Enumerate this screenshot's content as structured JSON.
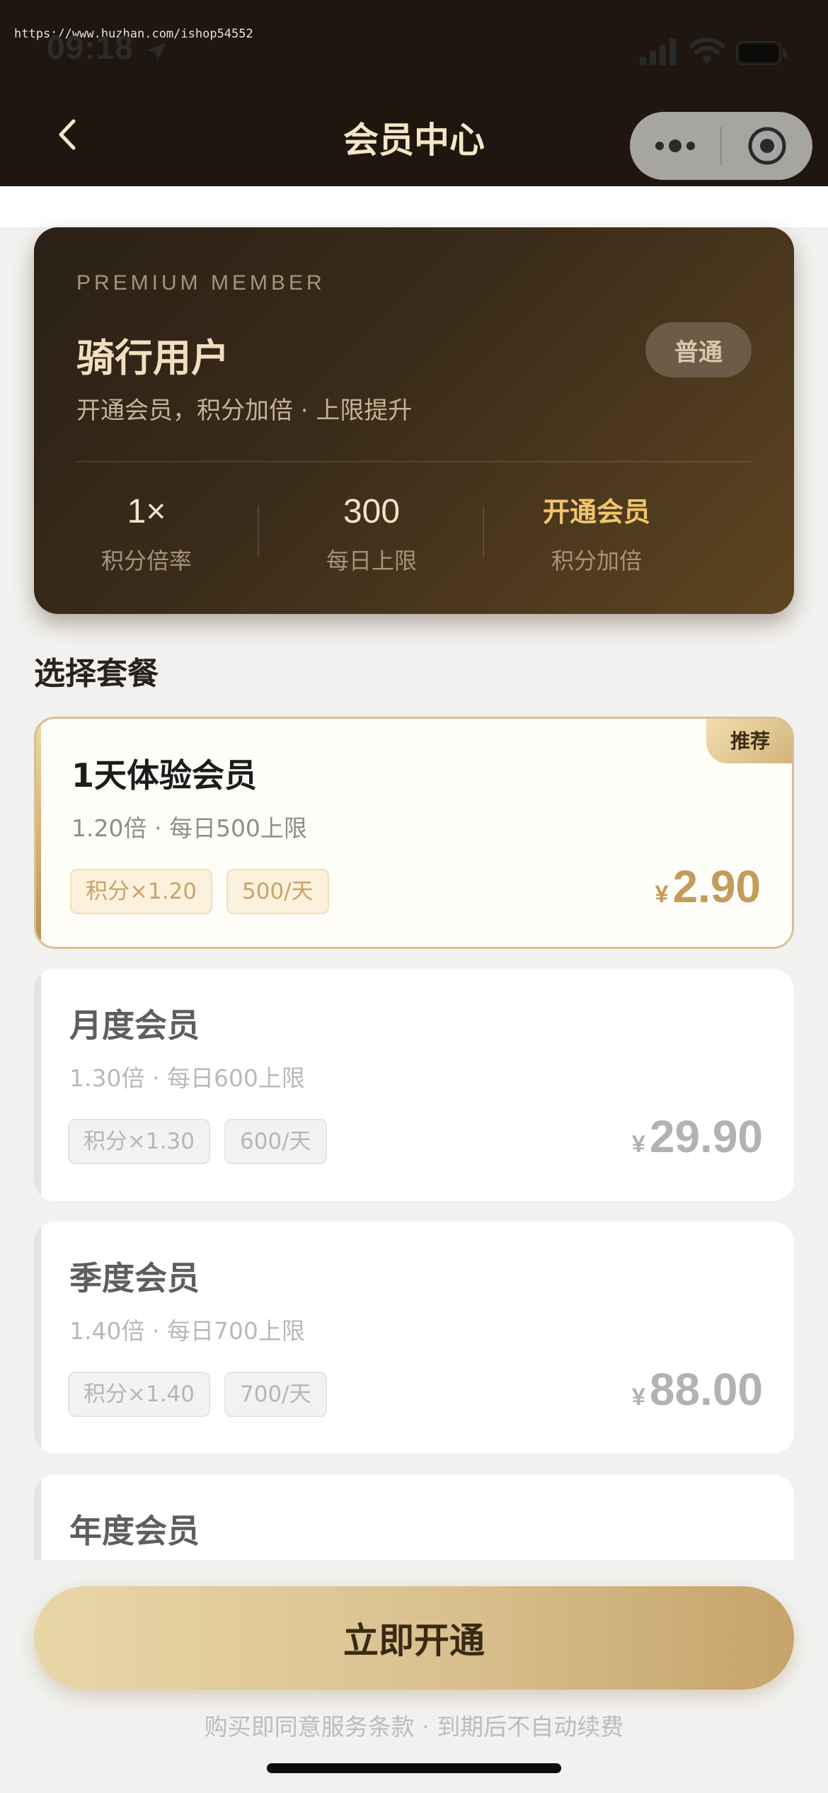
{
  "status_bar": {
    "watermark": "https://www.huzhan.com/ishop54552",
    "time": "09:18"
  },
  "header": {
    "title": "会员中心"
  },
  "member_card": {
    "eyebrow": "PREMIUM MEMBER",
    "title": "骑行用户",
    "subtitle": "开通会员，积分加倍 · 上限提升",
    "level_badge": "普通",
    "stats": [
      {
        "value": "1×",
        "label": "积分倍率"
      },
      {
        "value": "300",
        "label": "每日上限"
      },
      {
        "value": "开通会员",
        "label": "积分加倍"
      }
    ]
  },
  "section_title": "选择套餐",
  "plans": [
    {
      "name": "1天体验会员",
      "desc": "1.20倍 · 每日500上限",
      "tags": [
        "积分×1.20",
        "500/天"
      ],
      "currency": "¥",
      "price": "2.90",
      "badge": "推荐",
      "selected": true
    },
    {
      "name": "月度会员",
      "desc": "1.30倍 · 每日600上限",
      "tags": [
        "积分×1.30",
        "600/天"
      ],
      "currency": "¥",
      "price": "29.90",
      "selected": false
    },
    {
      "name": "季度会员",
      "desc": "1.40倍 · 每日700上限",
      "tags": [
        "积分×1.40",
        "700/天"
      ],
      "currency": "¥",
      "price": "88.00",
      "selected": false
    },
    {
      "name": "年度会员",
      "selected": false
    }
  ],
  "cta": {
    "label": "立即开通"
  },
  "footer": {
    "terms": "购买即同意服务条款 · 到期后不自动续费"
  },
  "colors": {
    "header_bg": "#1f170f",
    "accent_gold": "#c49b5a",
    "title_text": "#f4e6c6"
  },
  "icons": [
    "back-chevron-icon",
    "more-dots-icon",
    "close-target-icon",
    "location-arrow-icon",
    "signal-icon",
    "wifi-icon",
    "battery-icon"
  ]
}
